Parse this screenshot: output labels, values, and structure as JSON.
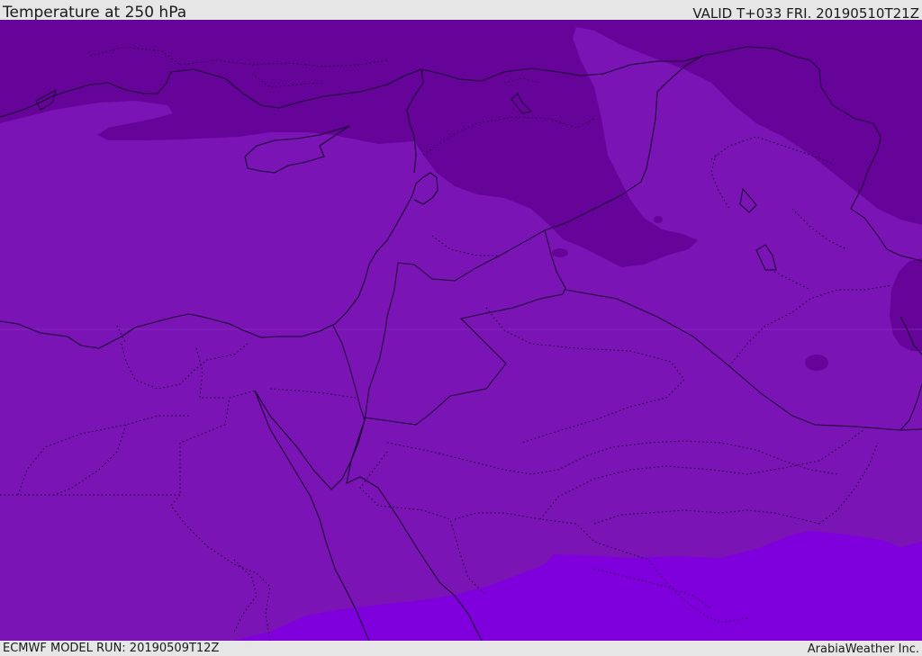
{
  "header": {
    "title": "Temperature at 250 hPa",
    "valid_time": "VALID T+033 FRI. 20190510T21Z"
  },
  "footer": {
    "model_run": "ECMWF MODEL RUN: 20190509T12Z",
    "credit": "ArabiaWeather Inc."
  },
  "map": {
    "variable": "temperature",
    "level": "250 hPa",
    "colors": {
      "mid_band": "#7a14b4",
      "cold_band": "#660499",
      "warm_band": "#7f00dc",
      "lines": "#1a0033"
    }
  }
}
